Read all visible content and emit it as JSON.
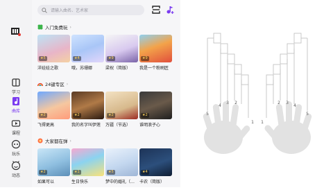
{
  "search": {
    "placeholder": "请输入曲名、艺术家"
  },
  "nav": [
    {
      "label": "学习",
      "icon": "book-icon"
    },
    {
      "label": "曲库",
      "icon": "music-library-icon"
    },
    {
      "label": "课程",
      "icon": "course-icon"
    },
    {
      "label": "玩乐",
      "icon": "gamepad-icon"
    },
    {
      "label": "动态",
      "icon": "community-icon"
    }
  ],
  "sections": [
    {
      "title": "入门免费玩",
      "cards": [
        {
          "title": "洋娃娃之歌",
          "rating": "★5"
        },
        {
          "title": "哦，苏珊娜",
          "rating": "★4"
        },
        {
          "title": "梁祝（简版）",
          "rating": "★9"
        },
        {
          "title": "我是一个粉刷匠",
          "rating": "★9"
        }
      ]
    },
    {
      "title": "24键专区",
      "cards": [
        {
          "title": "飞得更高",
          "rating": "★2"
        },
        {
          "title": "我的名字叫伊莲",
          "rating": "★2"
        },
        {
          "title": "万疆（节选）",
          "rating": "★2"
        },
        {
          "title": "谁明浪子心",
          "rating": "★2"
        }
      ]
    },
    {
      "title": "大家都在弹",
      "cards": [
        {
          "title": "如果可以",
          "rating": "★2"
        },
        {
          "title": "生日快乐",
          "rating": "★1"
        },
        {
          "title": "梦中的婚礼（…",
          "rating": "★5"
        },
        {
          "title": "卡农（简版）",
          "rating": "★4"
        }
      ]
    }
  ],
  "finger_numbers": [
    "5",
    "4",
    "3",
    "2",
    "1",
    "1",
    "2",
    "3",
    "4",
    "5"
  ]
}
